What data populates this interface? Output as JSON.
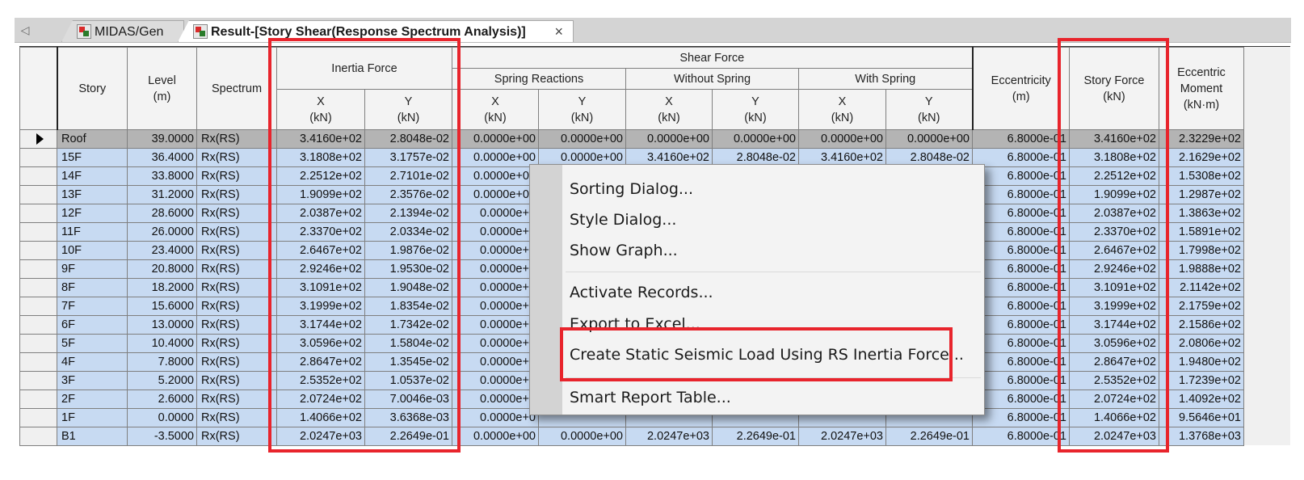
{
  "tabs": {
    "midas_label": "MIDAS/Gen",
    "result_label": "Result-[Story Shear(Response Spectrum Analysis)]",
    "close_glyph": "×",
    "scroll_glyph": "◁"
  },
  "table": {
    "headers": {
      "story": "Story",
      "level": "Level\n(m)",
      "spectrum": "Spectrum",
      "inertia_force": "Inertia Force",
      "shear_force": "Shear Force",
      "spring_reactions": "Spring Reactions",
      "without_spring": "Without Spring",
      "with_spring": "With Spring",
      "eccentricity": "Eccentricity\n(m)",
      "story_force": "Story Force\n(kN)",
      "eccentric_moment": "Eccentric\nMoment\n(kN·m)",
      "x_kn": "X\n(kN)",
      "y_kn": "Y\n(kN)"
    },
    "rows": [
      {
        "story": "Roof",
        "level": "39.0000",
        "spectrum": "Rx(RS)",
        "ix": "3.4160e+02",
        "iy": "2.8048e-02",
        "srx": "0.0000e+00",
        "sry": "0.0000e+00",
        "wox": "0.0000e+00",
        "woy": "0.0000e+00",
        "wx": "0.0000e+00",
        "wy": "0.0000e+00",
        "ecc": "6.8000e-01",
        "sf": "3.4160e+02",
        "em": "2.3229e+02"
      },
      {
        "story": "15F",
        "level": "36.4000",
        "spectrum": "Rx(RS)",
        "ix": "3.1808e+02",
        "iy": "3.1757e-02",
        "srx": "0.0000e+00",
        "sry": "0.0000e+00",
        "wox": "3.4160e+02",
        "woy": "2.8048e-02",
        "wx": "3.4160e+02",
        "wy": "2.8048e-02",
        "ecc": "6.8000e-01",
        "sf": "3.1808e+02",
        "em": "2.1629e+02"
      },
      {
        "story": "14F",
        "level": "33.8000",
        "spectrum": "Rx(RS)",
        "ix": "2.2512e+02",
        "iy": "2.7101e-02",
        "srx": "0.0000e+00",
        "sry": "",
        "wox": "",
        "woy": "",
        "wx": "",
        "wy": "",
        "ecc": "6.8000e-01",
        "sf": "2.2512e+02",
        "em": "1.5308e+02"
      },
      {
        "story": "13F",
        "level": "31.2000",
        "spectrum": "Rx(RS)",
        "ix": "1.9099e+02",
        "iy": "2.3576e-02",
        "srx": "0.0000e+00",
        "sry": "",
        "wox": "",
        "woy": "",
        "wx": "",
        "wy": "",
        "ecc": "6.8000e-01",
        "sf": "1.9099e+02",
        "em": "1.2987e+02"
      },
      {
        "story": "12F",
        "level": "28.6000",
        "spectrum": "Rx(RS)",
        "ix": "2.0387e+02",
        "iy": "2.1394e-02",
        "srx": "0.0000e+0",
        "sry": "",
        "wox": "",
        "woy": "",
        "wx": "",
        "wy": "",
        "ecc": "6.8000e-01",
        "sf": "2.0387e+02",
        "em": "1.3863e+02"
      },
      {
        "story": "11F",
        "level": "26.0000",
        "spectrum": "Rx(RS)",
        "ix": "2.3370e+02",
        "iy": "2.0334e-02",
        "srx": "0.0000e+0",
        "sry": "",
        "wox": "",
        "woy": "",
        "wx": "",
        "wy": "",
        "ecc": "6.8000e-01",
        "sf": "2.3370e+02",
        "em": "1.5891e+02"
      },
      {
        "story": "10F",
        "level": "23.4000",
        "spectrum": "Rx(RS)",
        "ix": "2.6467e+02",
        "iy": "1.9876e-02",
        "srx": "0.0000e+0",
        "sry": "",
        "wox": "",
        "woy": "",
        "wx": "",
        "wy": "",
        "ecc": "6.8000e-01",
        "sf": "2.6467e+02",
        "em": "1.7998e+02"
      },
      {
        "story": "9F",
        "level": "20.8000",
        "spectrum": "Rx(RS)",
        "ix": "2.9246e+02",
        "iy": "1.9530e-02",
        "srx": "0.0000e+0",
        "sry": "",
        "wox": "",
        "woy": "",
        "wx": "",
        "wy": "",
        "ecc": "6.8000e-01",
        "sf": "2.9246e+02",
        "em": "1.9888e+02"
      },
      {
        "story": "8F",
        "level": "18.2000",
        "spectrum": "Rx(RS)",
        "ix": "3.1091e+02",
        "iy": "1.9048e-02",
        "srx": "0.0000e+0",
        "sry": "",
        "wox": "",
        "woy": "",
        "wx": "",
        "wy": "",
        "ecc": "6.8000e-01",
        "sf": "3.1091e+02",
        "em": "2.1142e+02"
      },
      {
        "story": "7F",
        "level": "15.6000",
        "spectrum": "Rx(RS)",
        "ix": "3.1999e+02",
        "iy": "1.8354e-02",
        "srx": "0.0000e+0",
        "sry": "",
        "wox": "",
        "woy": "",
        "wx": "",
        "wy": "",
        "ecc": "6.8000e-01",
        "sf": "3.1999e+02",
        "em": "2.1759e+02"
      },
      {
        "story": "6F",
        "level": "13.0000",
        "spectrum": "Rx(RS)",
        "ix": "3.1744e+02",
        "iy": "1.7342e-02",
        "srx": "0.0000e+0",
        "sry": "",
        "wox": "",
        "woy": "",
        "wx": "",
        "wy": "",
        "ecc": "6.8000e-01",
        "sf": "3.1744e+02",
        "em": "2.1586e+02"
      },
      {
        "story": "5F",
        "level": "10.4000",
        "spectrum": "Rx(RS)",
        "ix": "3.0596e+02",
        "iy": "1.5804e-02",
        "srx": "0.0000e+0",
        "sry": "",
        "wox": "",
        "woy": "",
        "wx": "",
        "wy": "",
        "ecc": "6.8000e-01",
        "sf": "3.0596e+02",
        "em": "2.0806e+02"
      },
      {
        "story": "4F",
        "level": "7.8000",
        "spectrum": "Rx(RS)",
        "ix": "2.8647e+02",
        "iy": "1.3545e-02",
        "srx": "0.0000e+0",
        "sry": "",
        "wox": "",
        "woy": "",
        "wx": "",
        "wy": "",
        "ecc": "6.8000e-01",
        "sf": "2.8647e+02",
        "em": "1.9480e+02"
      },
      {
        "story": "3F",
        "level": "5.2000",
        "spectrum": "Rx(RS)",
        "ix": "2.5352e+02",
        "iy": "1.0537e-02",
        "srx": "0.0000e+0",
        "sry": "",
        "wox": "",
        "woy": "",
        "wx": "",
        "wy": "",
        "ecc": "6.8000e-01",
        "sf": "2.5352e+02",
        "em": "1.7239e+02"
      },
      {
        "story": "2F",
        "level": "2.6000",
        "spectrum": "Rx(RS)",
        "ix": "2.0724e+02",
        "iy": "7.0046e-03",
        "srx": "0.0000e+0",
        "sry": "",
        "wox": "",
        "woy": "",
        "wx": "",
        "wy": "",
        "ecc": "6.8000e-01",
        "sf": "2.0724e+02",
        "em": "1.4092e+02"
      },
      {
        "story": "1F",
        "level": "0.0000",
        "spectrum": "Rx(RS)",
        "ix": "1.4066e+02",
        "iy": "3.6368e-03",
        "srx": "0.0000e+0",
        "sry": "",
        "wox": "",
        "woy": "",
        "wx": "",
        "wy": "",
        "ecc": "6.8000e-01",
        "sf": "1.4066e+02",
        "em": "9.5646e+01"
      },
      {
        "story": "B1",
        "level": "-3.5000",
        "spectrum": "Rx(RS)",
        "ix": "2.0247e+03",
        "iy": "2.2649e-01",
        "srx": "0.0000e+00",
        "sry": "0.0000e+00",
        "wox": "2.0247e+03",
        "woy": "2.2649e-01",
        "wx": "2.0247e+03",
        "wy": "2.2649e-01",
        "ecc": "6.8000e-01",
        "sf": "2.0247e+03",
        "em": "1.3768e+03"
      }
    ]
  },
  "context_menu": {
    "items": [
      "Sorting Dialog...",
      "Style Dialog...",
      "Show Graph...",
      "Activate Records...",
      "Export to Excel...",
      "Create Static Seismic Load Using RS Inertia Force...",
      "Smart Report Table..."
    ]
  },
  "colors": {
    "highlight": "#e8242c",
    "row_fill": "#c7daf2",
    "selected_row": "#b4b4b4"
  }
}
